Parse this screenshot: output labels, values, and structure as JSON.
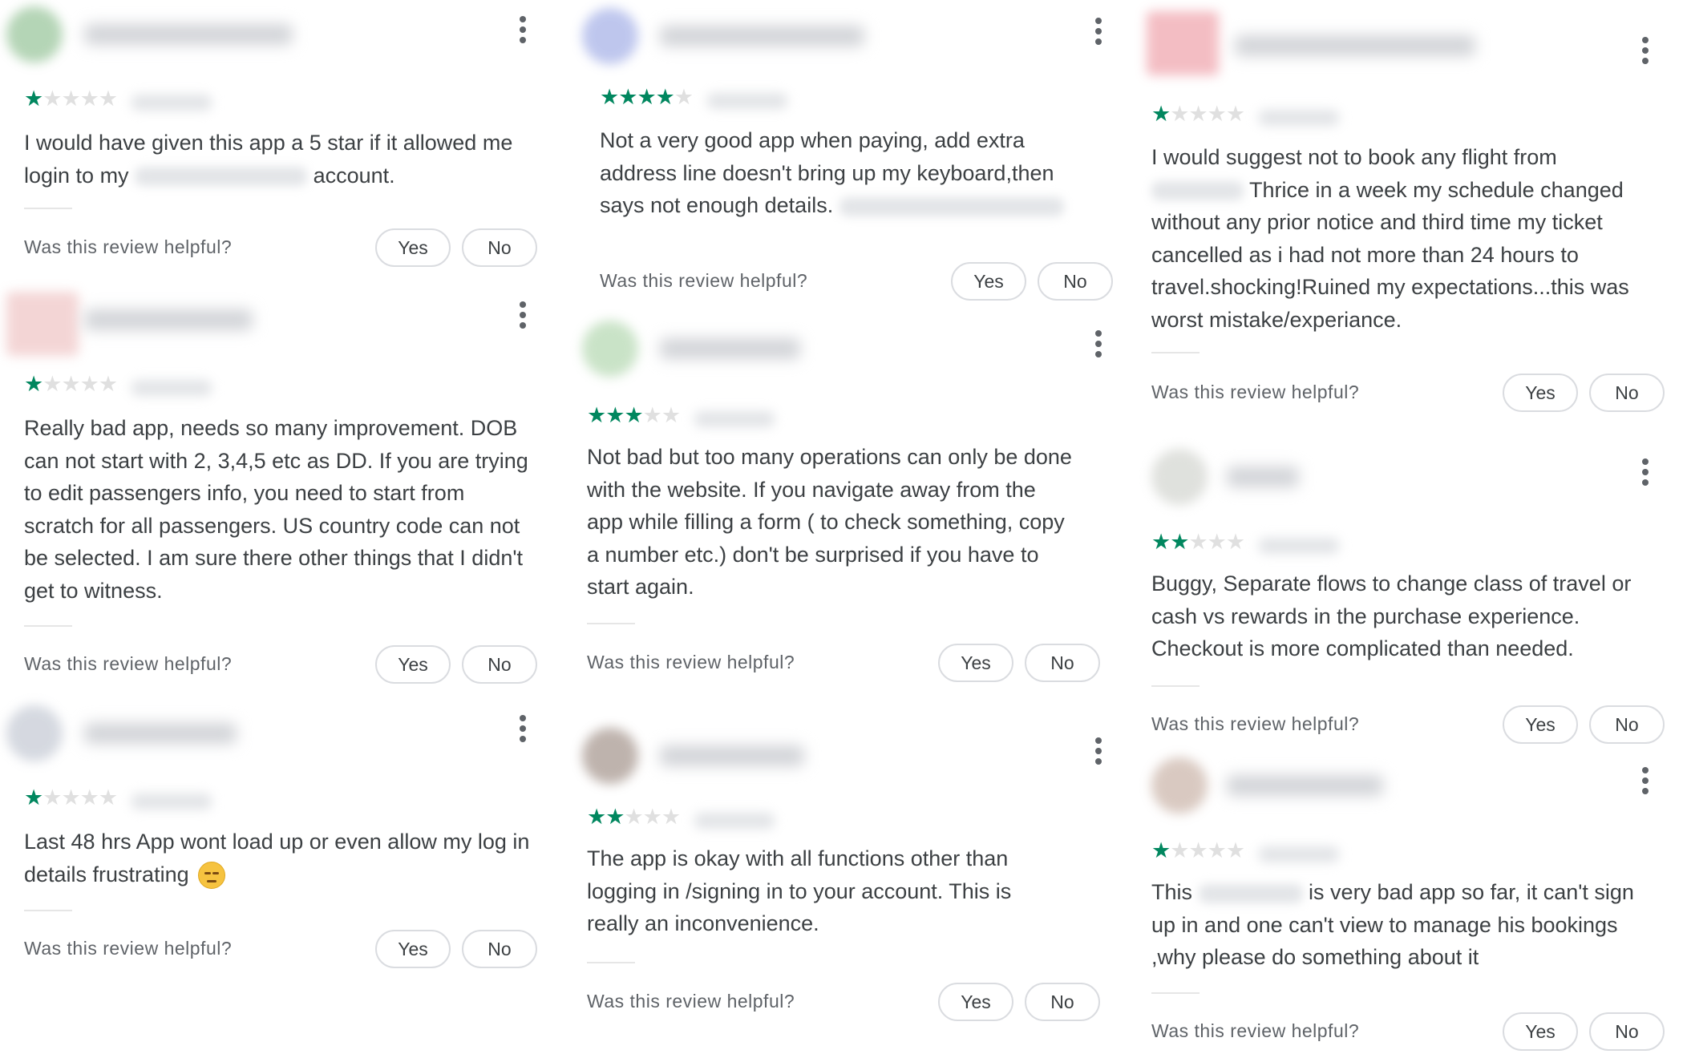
{
  "page": {
    "helpful_question": "Was this review helpful?",
    "yes_label": "Yes",
    "no_label": "No"
  },
  "colors": {
    "star_filled": "#01875f",
    "star_empty": "#e0e0e0",
    "text": "#3c4043",
    "muted_text": "#5f6368",
    "button_border": "#dadce0"
  },
  "icons": {
    "more": "more-vert-icon (three vertical dots)",
    "star": "star-icon",
    "emoji": "pensive-face-emoji"
  },
  "reviews": [
    {
      "rating": 1,
      "text_parts": [
        "I would have given this app a 5 star if it allowed me login to my",
        "account."
      ]
    },
    {
      "rating": 1,
      "text": "Really bad app, needs so many improvement. DOB can not start with 2, 3,4,5 etc as DD. If you are trying to edit passengers info, you need to start from scratch for all passengers. US country code can not be selected. I am sure there other things that I didn't get to witness."
    },
    {
      "rating": 1,
      "text": "Last 48 hrs App wont load up or even allow my log in details frustrating"
    },
    {
      "rating": 4,
      "text": "Not a very good app when paying, add extra address line doesn't bring up my keyboard,then says not enough details."
    },
    {
      "rating": 3,
      "text": "Not bad but too many operations can only be done with the website. If you navigate away from the app while filling a form ( to check something, copy a number etc.) don't be surprised if you have to start again."
    },
    {
      "rating": 2,
      "text": "The app is okay with all functions other than logging in /signing in to your account. This is really an inconvenience."
    },
    {
      "rating": 1,
      "text_parts": [
        "I would suggest not to book any flight from",
        "Thrice in a week my schedule changed without any prior notice and third time my ticket cancelled as i had not more than 24 hours to travel.shocking!Ruined my expectations...this was worst mistake/experiance."
      ]
    },
    {
      "rating": 2,
      "text": "Buggy, Separate flows to change class of travel or cash vs rewards in the purchase experience. Checkout is more complicated than needed."
    },
    {
      "rating": 1,
      "text_parts": [
        "This",
        "is very bad app so far, it can't sign up in and one can't view to manage his bookings ,why please do something about it"
      ]
    }
  ]
}
